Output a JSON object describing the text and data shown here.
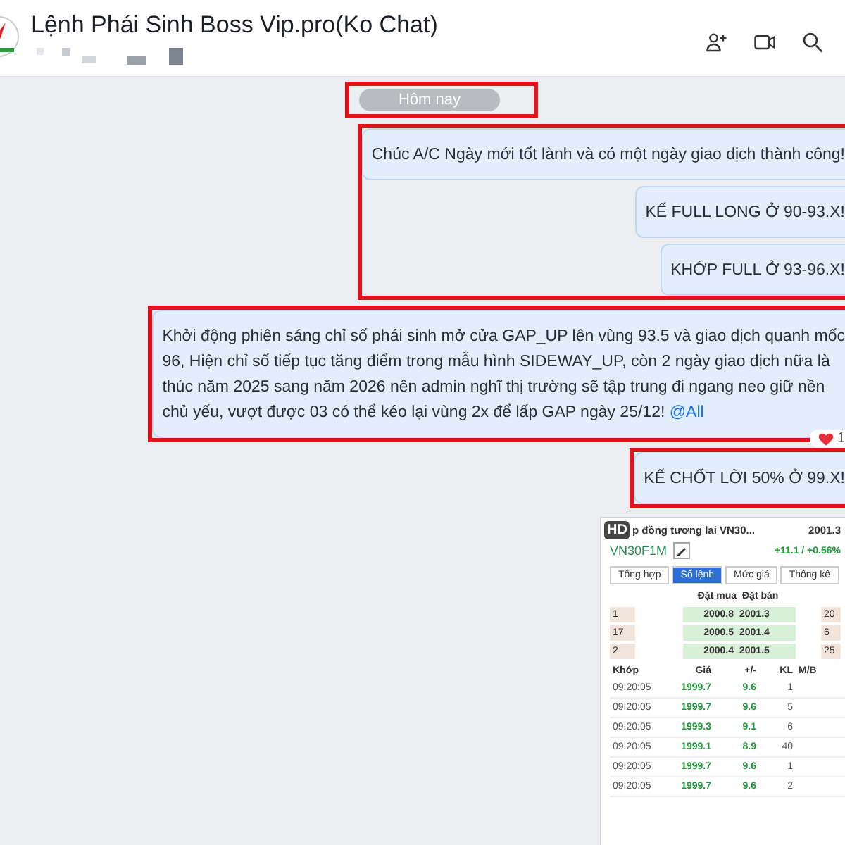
{
  "header": {
    "title": "Lệnh Phái Sinh Boss Vip.pro(Ko Chat)"
  },
  "date_divider": {
    "label": "Hôm nay",
    "highlighted": true
  },
  "message_groups": [
    {
      "highlighted": true,
      "messages": [
        {
          "lines": [
            "Chúc A/C Ngày mới tốt lành và có một ngày giao dịch thành công!"
          ]
        },
        {
          "lines": [
            "KẾ FULL LONG Ở 90-93.X!"
          ]
        },
        {
          "lines": [
            "KHỚP FULL Ở 93-96.X!"
          ]
        }
      ]
    },
    {
      "highlighted": true,
      "messages": [
        {
          "lines": [
            "Khởi động phiên sáng chỉ số phái sinh mở cửa GAP_UP lên vùng 93.5 và giao dịch quanh mốc",
            "96, Hiện chỉ số tiếp tục tăng điểm trong mẫu hình SIDEWAY_UP, còn 2 ngày giao dịch nữa là",
            "thúc năm 2025 sang năm 2026 nên admin nghĩ thị trường sẽ tập trung đi ngang neo giữ nền",
            "chủ yếu, vượt được 03 có thể kéo lại vùng 2x để lấp GAP ngày 25/12!"
          ],
          "mention": "@All",
          "reaction": "1"
        }
      ]
    },
    {
      "highlighted": true,
      "messages": [
        {
          "lines": [
            "KẾ CHỐT LỜI 50% Ở 99.X!"
          ]
        }
      ]
    }
  ],
  "shared_image": {
    "badge": "HD",
    "title": "p đồng tương lai VN30...",
    "price": "2001.3",
    "symbol": "VN30F1M",
    "change": "+11.1 / +0.56%",
    "tabs": [
      {
        "label": "Tổng hợp",
        "selected": false
      },
      {
        "label": "Sổ lệnh",
        "selected": true
      },
      {
        "label": "Mức giá",
        "selected": false
      },
      {
        "label": "Thống kê",
        "selected": false
      }
    ],
    "book_columns": [
      "Đặt mua",
      "Đặt bán"
    ],
    "book_rows": [
      {
        "qty": "1",
        "bid": "2000.8",
        "ask": "2001.3",
        "ask_qty": "20"
      },
      {
        "qty": "17",
        "bid": "2000.5",
        "ask": "2001.4",
        "ask_qty": "6"
      },
      {
        "qty": "2",
        "bid": "2000.4",
        "ask": "2001.5",
        "ask_qty": "25"
      }
    ],
    "trade_columns": [
      "Khớp",
      "Giá",
      "+/-",
      "KL",
      "M/B"
    ],
    "trades": [
      [
        "09:20:05",
        "1999.7",
        "9.6",
        "1"
      ],
      [
        "09:20:05",
        "1999.7",
        "9.6",
        "5"
      ],
      [
        "09:20:05",
        "1999.3",
        "9.1",
        "6"
      ],
      [
        "09:20:05",
        "1999.1",
        "8.9",
        "40"
      ],
      [
        "09:20:05",
        "1999.7",
        "9.6",
        "1"
      ],
      [
        "09:20:05",
        "1999.7",
        "9.6",
        "2"
      ]
    ]
  }
}
